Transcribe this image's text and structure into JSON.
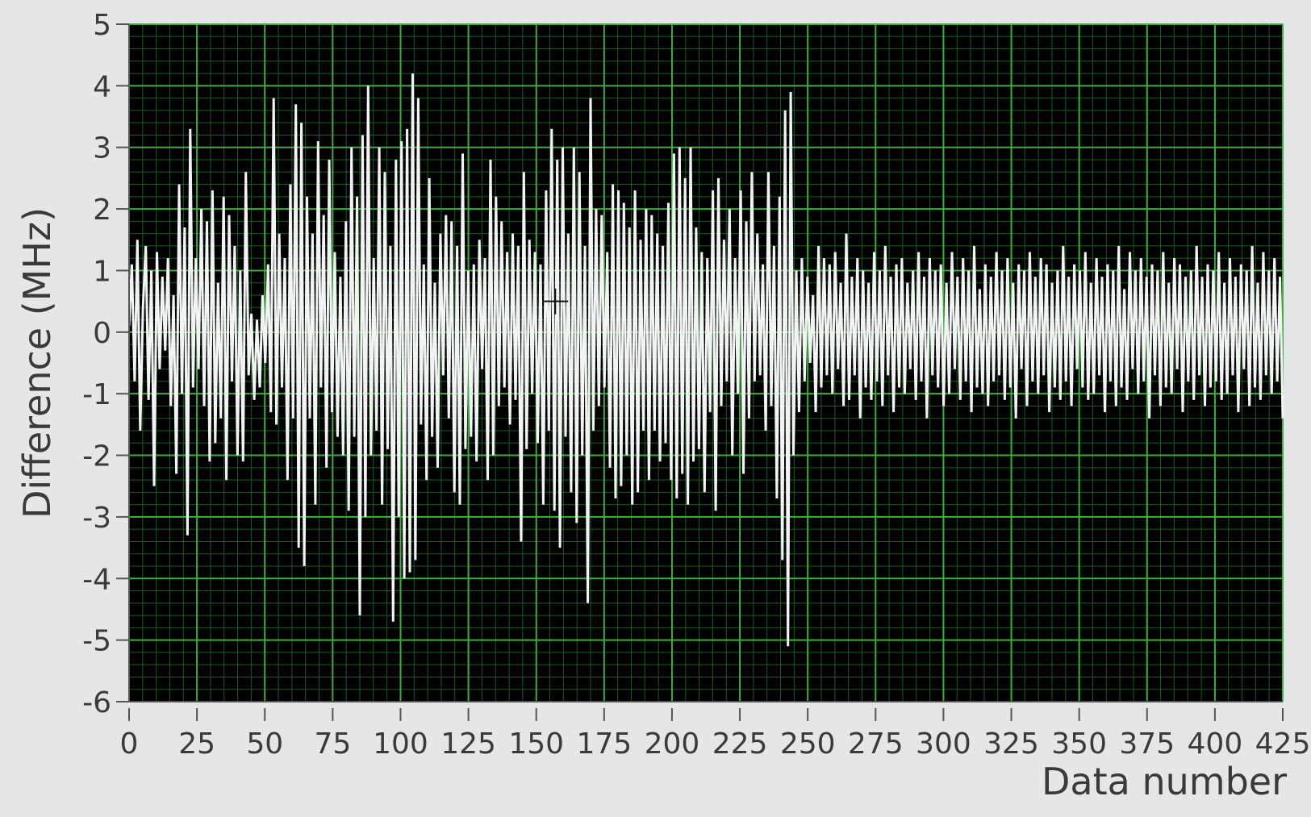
{
  "chart_data": {
    "type": "line",
    "title": "",
    "xlabel": "Data number",
    "ylabel": "Difference (MHz)",
    "xlim": [
      0,
      425
    ],
    "ylim": [
      -6,
      5
    ],
    "x_ticks": [
      0,
      25,
      50,
      75,
      100,
      125,
      150,
      175,
      200,
      225,
      250,
      275,
      300,
      325,
      350,
      375,
      400,
      425
    ],
    "y_ticks": [
      5,
      4,
      3,
      2,
      1,
      0,
      -1,
      -2,
      -3,
      -4,
      -5,
      -6
    ],
    "x_tick_labels": [
      "0",
      "25",
      "50",
      "75",
      "100",
      "125",
      "150",
      "175",
      "200",
      "225",
      "250",
      "275",
      "300",
      "325",
      "350",
      "375",
      "400",
      "425"
    ],
    "y_tick_labels": [
      "5",
      "4",
      "3",
      "2",
      "1",
      "0",
      "-1",
      "-2",
      "-3",
      "-4",
      "-5",
      "-6"
    ],
    "grid": true,
    "legend": "none",
    "colors": {
      "plot_background": "#000000",
      "grid_major": "#3fae3f",
      "grid_minor": "#1f5a1f",
      "series": "#f2f4f4",
      "page_background": "#e4e6e7",
      "text": "#3a3a3a"
    },
    "series": [
      {
        "values": [
          0.1,
          1.1,
          -0.8,
          1.5,
          -1.6,
          0.4,
          1.4,
          -1.1,
          1.0,
          -2.5,
          1.3,
          -0.6,
          0.9,
          -0.3,
          1.2,
          -1.2,
          0.6,
          -2.3,
          2.4,
          -1.0,
          1.7,
          -3.3,
          3.3,
          -0.9,
          1.2,
          -0.6,
          2.0,
          -1.2,
          1.8,
          -2.1,
          2.3,
          -1.8,
          0.8,
          -1.4,
          2.2,
          -2.4,
          1.9,
          -0.8,
          1.4,
          -2.0,
          1.0,
          -2.1,
          2.6,
          -0.7,
          0.3,
          -1.1,
          0.2,
          -0.9,
          0.6,
          -0.5,
          1.1,
          -1.3,
          3.8,
          -1.5,
          1.6,
          -0.9,
          1.2,
          -2.4,
          2.4,
          -1.4,
          3.7,
          -3.5,
          3.4,
          -3.8,
          2.2,
          -1.4,
          1.6,
          -2.8,
          3.1,
          -0.9,
          1.9,
          -2.2,
          2.8,
          -1.3,
          1.3,
          -1.7,
          0.9,
          -2.0,
          1.8,
          -2.9,
          3.0,
          -1.7,
          2.2,
          -4.6,
          3.2,
          -3.0,
          4.0,
          -2.0,
          1.2,
          -1.6,
          3.0,
          -2.8,
          2.6,
          -1.9,
          1.4,
          -4.7,
          2.8,
          -3.0,
          3.1,
          -4.0,
          3.3,
          -3.9,
          4.2,
          -3.7,
          3.8,
          -1.5,
          1.1,
          -2.4,
          2.5,
          -1.7,
          0.8,
          -2.2,
          1.6,
          -0.7,
          1.9,
          -1.4,
          1.8,
          -2.6,
          1.4,
          -2.8,
          2.9,
          -1.9,
          1.0,
          -1.7,
          1.1,
          -2.1,
          1.5,
          -0.6,
          1.2,
          -2.4,
          2.8,
          -2.0,
          2.2,
          -1.2,
          1.8,
          -0.9,
          1.3,
          -1.5,
          1.6,
          -1.1,
          1.4,
          -3.4,
          2.6,
          -1.9,
          1.5,
          -1.0,
          1.3,
          -1.8,
          1.1,
          -2.8,
          2.3,
          -1.6,
          3.3,
          -2.9,
          2.8,
          -3.5,
          3.0,
          -1.7,
          1.6,
          -2.6,
          3.0,
          -3.1,
          2.6,
          -2.0,
          1.4,
          -4.4,
          3.8,
          -1.6,
          2.0,
          -1.2,
          1.9,
          -0.9,
          1.3,
          -2.2,
          2.4,
          -2.7,
          2.3,
          -2.5,
          2.1,
          -2.0,
          1.7,
          -2.8,
          2.3,
          -2.6,
          1.5,
          -1.6,
          2.0,
          -2.4,
          1.9,
          -1.6,
          1.6,
          -2.1,
          1.4,
          -1.8,
          2.1,
          -2.4,
          2.9,
          -2.7,
          3.0,
          -2.3,
          2.5,
          -2.8,
          3.0,
          -2.1,
          1.7,
          -1.9,
          1.3,
          -2.6,
          1.2,
          -1.3,
          2.3,
          -2.9,
          2.5,
          -1.2,
          1.5,
          -0.8,
          2.0,
          -2.0,
          1.2,
          -1.0,
          2.3,
          -2.3,
          1.8,
          -1.4,
          2.6,
          -0.8,
          1.6,
          -0.7,
          1.1,
          -1.6,
          2.6,
          -1.2,
          1.4,
          -2.7,
          2.2,
          -3.7,
          3.6,
          -5.1,
          3.9,
          -2.0,
          1.0,
          -1.3,
          1.2,
          -0.8,
          0.9,
          -0.5,
          0.6,
          -1.3,
          1.4,
          -0.9,
          1.2,
          -0.7,
          1.1,
          -1.0,
          1.3,
          -0.6,
          0.8,
          -1.2,
          1.6,
          -1.1,
          0.9,
          -0.7,
          1.2,
          -1.4,
          1.0,
          -0.9,
          0.8,
          -1.1,
          1.3,
          -0.8,
          1.0,
          -1.2,
          1.4,
          -0.7,
          0.9,
          -1.3,
          1.1,
          -0.9,
          1.2,
          -1.0,
          0.8,
          -0.6,
          1.0,
          -1.1,
          1.3,
          -0.8,
          0.9,
          -1.4,
          1.2,
          -0.7,
          1.0,
          -0.9,
          1.1,
          -1.2,
          0.8,
          -1.0,
          1.3,
          -0.6,
          0.9,
          -1.1,
          1.2,
          -0.8,
          1.0,
          -1.3,
          1.4,
          -0.9,
          0.7,
          -1.0,
          1.1,
          -1.2,
          0.9,
          -0.8,
          1.3,
          -0.7,
          1.0,
          -1.1,
          1.2,
          -0.9,
          0.8,
          -1.4,
          1.1,
          -0.6,
          1.0,
          -1.2,
          1.3,
          -0.8,
          0.9,
          -1.0,
          1.2,
          -0.7,
          1.1,
          -1.3,
          0.8,
          -0.9,
          1.0,
          -1.1,
          1.4,
          -0.8,
          0.9,
          -1.2,
          1.1,
          -0.6,
          1.0,
          -0.9,
          1.3,
          -1.1,
          0.8,
          -1.0,
          1.2,
          -0.7,
          0.9,
          -1.3,
          1.1,
          -0.8,
          1.0,
          -1.2,
          1.4,
          -0.9,
          0.7,
          -1.1,
          1.3,
          -0.6,
          1.0,
          -1.0,
          1.2,
          -0.8,
          0.9,
          -1.4,
          1.1,
          -0.7,
          1.0,
          -1.2,
          1.3,
          -0.9,
          0.8,
          -1.0,
          1.2,
          -0.6,
          1.1,
          -1.3,
          0.9,
          -0.8,
          1.0,
          -1.1,
          1.4,
          -0.7,
          0.9,
          -1.2,
          1.1,
          -0.9,
          1.0,
          -0.8,
          1.3,
          -1.1,
          0.8,
          -1.0,
          1.2,
          -0.7,
          0.9,
          -1.3,
          1.1,
          -0.6,
          1.0,
          -1.2,
          1.4,
          -0.9,
          0.8,
          -1.1,
          1.3,
          -0.7,
          1.0,
          -1.0,
          1.2,
          -0.8,
          0.9,
          -1.4
        ]
      }
    ],
    "annotations": [
      "crosshair cursor near x=157, y=0.5"
    ]
  }
}
